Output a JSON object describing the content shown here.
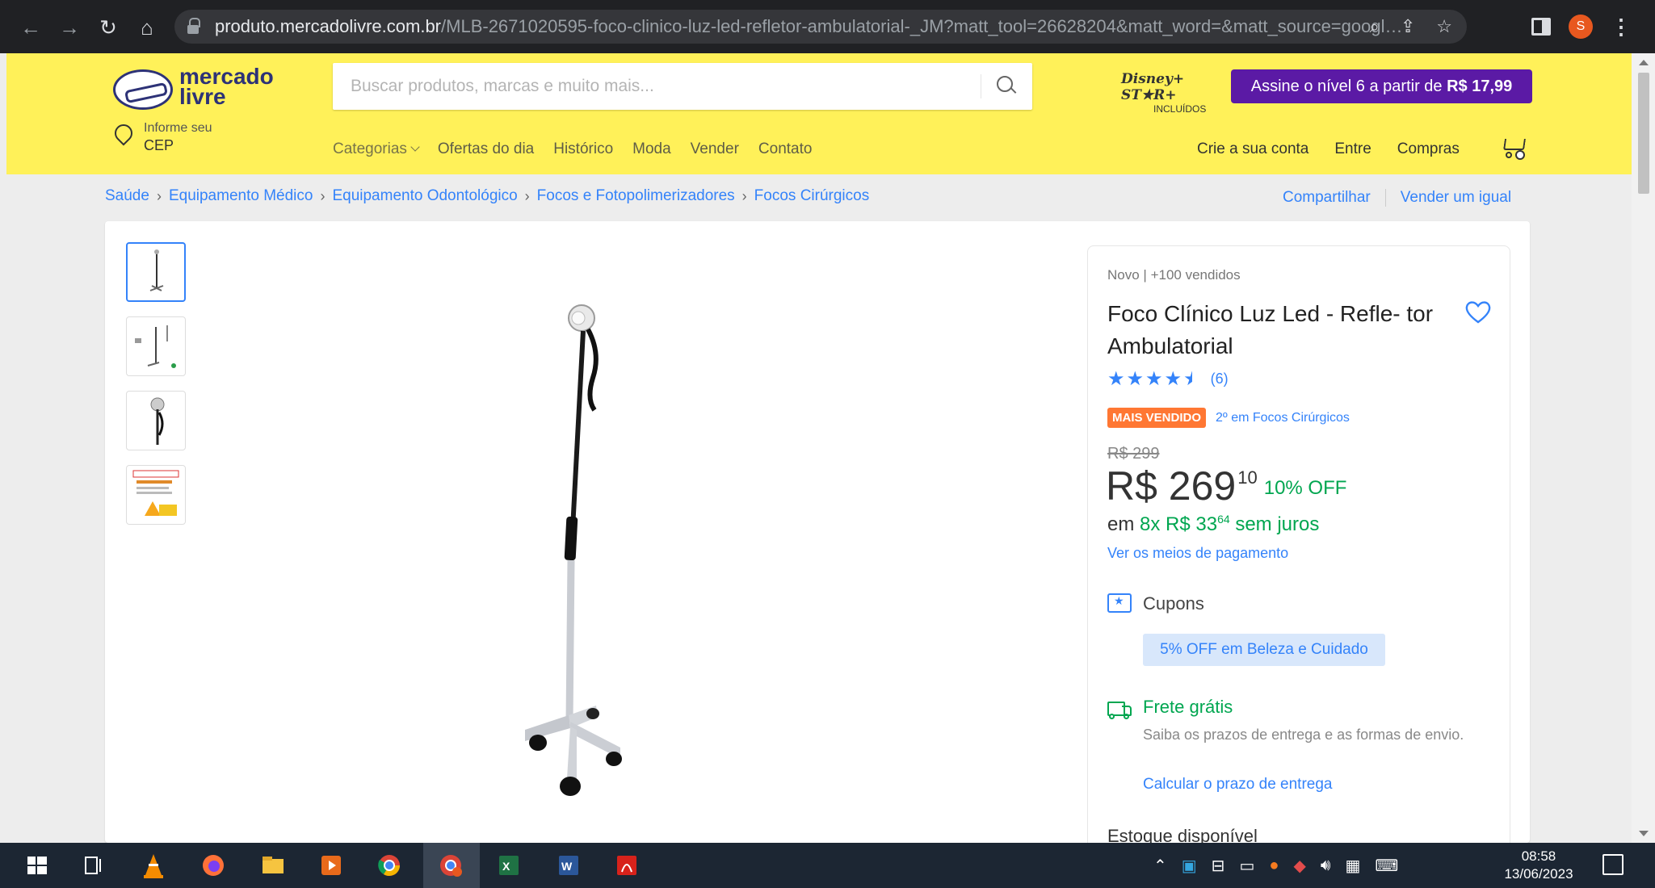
{
  "browser": {
    "url_host": "produto.mercadolivre.com.br",
    "url_path": "/MLB-2671020595-foco-clinico-luz-led-refletor-ambulatorial-_JM?matt_tool=26628204&matt_word=&matt_source=google&m...",
    "profile_initial": "S"
  },
  "header": {
    "logo_line1": "mercado",
    "logo_line2": "livre",
    "search_placeholder": "Buscar produtos, marcas e muito mais...",
    "disney_logo": "Disney+ ST★R+",
    "disney_sub": "INCLUÍDOS",
    "promo_text": "Assine o nível 6 a partir de ",
    "promo_price": "R$ 17,99",
    "cep_label": "Informe seu",
    "cep_value": "CEP",
    "menu": [
      "Categorias",
      "Ofertas do dia",
      "Histórico",
      "Moda",
      "Vender",
      "Contato"
    ],
    "account": [
      "Crie a sua conta",
      "Entre",
      "Compras"
    ]
  },
  "breadcrumb": [
    "Saúde",
    "Equipamento Médico",
    "Equipamento Odontológico",
    "Focos e Fotopolimerizadores",
    "Focos Cirúrgicos"
  ],
  "share": {
    "share_label": "Compartilhar",
    "sell_label": "Vender um igual"
  },
  "product": {
    "condition": "Novo",
    "sold": "+100 vendidos",
    "title": "Foco Clínico Luz Led - Refle- tor Ambulatorial",
    "rating": 4.5,
    "reviews": "(6)",
    "badge": "MAIS VENDIDO",
    "badge_rank": "2º em Focos Cirúrgicos",
    "old_price": "R$ 299",
    "price_main": "R$ 269",
    "price_cents": "10",
    "discount": "10% OFF",
    "installments_prefix": "em ",
    "installments_value": "8x R$ 33",
    "installments_cents": "64",
    "installments_suffix": " sem juros",
    "payment_link": "Ver os meios de pagamento",
    "coupons_label": "Cupons",
    "coupon_chip": "5% OFF em Beleza e Cuidado",
    "shipping_label": "Frete grátis",
    "shipping_desc": "Saiba os prazos de entrega e as formas de envio.",
    "shipping_link": "Calcular o prazo de entrega",
    "stock": "Estoque disponível"
  },
  "taskbar": {
    "time": "08:58",
    "date": "13/06/2023"
  },
  "colors": {
    "header_yellow": "#fff159",
    "link_blue": "#3483fa",
    "green": "#00a650",
    "badge_orange": "#ff7733",
    "promo_purple": "#5b1aa5"
  }
}
